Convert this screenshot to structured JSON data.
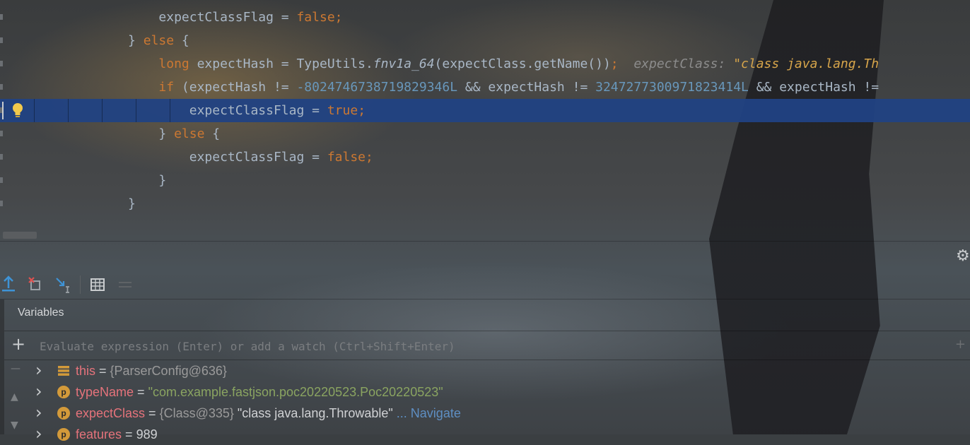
{
  "editor": {
    "lines": [
      {
        "indent": "            ",
        "parts": [
          {
            "t": "expectClassFlag = ",
            "c": "plain"
          },
          {
            "t": "false",
            "c": "kw"
          },
          {
            "t": ";",
            "c": "kw"
          }
        ]
      },
      {
        "indent": "        ",
        "parts": [
          {
            "t": "} ",
            "c": "plain"
          },
          {
            "t": "else",
            "c": "kw"
          },
          {
            "t": " {",
            "c": "plain"
          }
        ]
      },
      {
        "indent": "            ",
        "parts": [
          {
            "t": "long",
            "c": "kw"
          },
          {
            "t": " expectHash = TypeUtils.",
            "c": "plain"
          },
          {
            "t": "fnv1a_64",
            "c": "fn"
          },
          {
            "t": "(expectClass.getName())",
            "c": "plain"
          },
          {
            "t": ";",
            "c": "kw"
          },
          {
            "t": "  expectClass: ",
            "c": "hint-name"
          },
          {
            "t": "\"class java.lang.Th",
            "c": "hint-val"
          }
        ]
      },
      {
        "indent": "            ",
        "parts": [
          {
            "t": "if",
            "c": "kw"
          },
          {
            "t": " (expectHash != ",
            "c": "plain"
          },
          {
            "t": "-8024746738719829346L",
            "c": "num"
          },
          {
            "t": " && expectHash != ",
            "c": "plain"
          },
          {
            "t": "3247277300971823414L",
            "c": "num"
          },
          {
            "t": " && expectHash !=",
            "c": "plain"
          }
        ]
      },
      {
        "indent": "                ",
        "parts": [
          {
            "t": "expectClassFlag = ",
            "c": "plain"
          },
          {
            "t": "true",
            "c": "kw"
          },
          {
            "t": ";",
            "c": "kw"
          }
        ],
        "selected": true
      },
      {
        "indent": "            ",
        "parts": [
          {
            "t": "} ",
            "c": "plain"
          },
          {
            "t": "else",
            "c": "kw"
          },
          {
            "t": " {",
            "c": "plain"
          }
        ]
      },
      {
        "indent": "                ",
        "parts": [
          {
            "t": "expectClassFlag = ",
            "c": "plain"
          },
          {
            "t": "false",
            "c": "kw"
          },
          {
            "t": ";",
            "c": "kw"
          }
        ]
      },
      {
        "indent": "            ",
        "parts": [
          {
            "t": "}",
            "c": "plain"
          }
        ]
      },
      {
        "indent": "        ",
        "parts": [
          {
            "t": "}",
            "c": "plain"
          }
        ]
      }
    ]
  },
  "debugger": {
    "panel_title": "Variables",
    "eval_placeholder": "Evaluate expression (Enter) or add a watch (Ctrl+Shift+Enter)",
    "variables": [
      {
        "icon": "stack-icon",
        "name": "this",
        "eq": " = ",
        "ref": "{ParserConfig@636}",
        "value": "",
        "nav": ""
      },
      {
        "icon": "p",
        "name": "typeName",
        "eq": " = ",
        "ref": "",
        "string": "\"com.example.fastjson.poc20220523.Poc20220523\"",
        "value": "",
        "nav": ""
      },
      {
        "icon": "p",
        "name": "expectClass",
        "eq": " = ",
        "ref": "{Class@335} ",
        "value": "\"class java.lang.Throwable\"",
        "nav": " ... Navigate"
      },
      {
        "icon": "p",
        "name": "features",
        "eq": " = ",
        "ref": "",
        "value": "989",
        "nav": ""
      }
    ]
  },
  "colors": {
    "keyword": "#cc7832",
    "number": "#6897bb",
    "selection": "#214283",
    "var_name": "#e5737b",
    "string": "#8aa461",
    "navigate": "#5e8fc3"
  }
}
